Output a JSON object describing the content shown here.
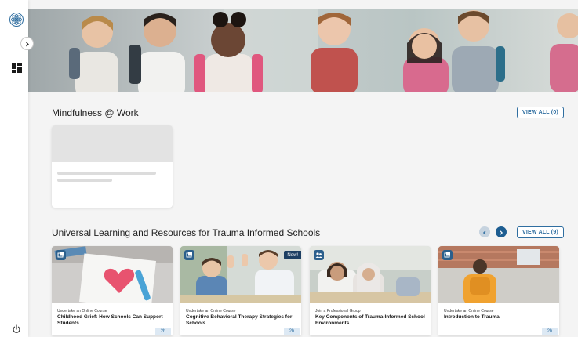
{
  "sidebar": {
    "logo_icon": "flower-logo-icon",
    "collapse_icon": "chevron-right-icon",
    "dashboard_icon": "dashboard-grid-icon",
    "power_icon": "power-icon"
  },
  "hero": {
    "image": "children-with-backpacks-photo"
  },
  "mindfulness": {
    "title": "Mindfulness @ Work",
    "view_all": "VIEW ALL (0)"
  },
  "trauma": {
    "title": "Universal Learning and Resources for Trauma Informed Schools",
    "view_all": "VIEW ALL (9)",
    "prev_icon": "chevron-left-icon",
    "next_icon": "chevron-right-icon",
    "cards": [
      {
        "type": "Undertake an Online Course",
        "title": "Childhood Grief: How Schools Can Support Students",
        "duration": "2h",
        "new": ""
      },
      {
        "type": "Undertake an Online Course",
        "title": "Cognitive Behavioral Therapy Strategies for Schools",
        "duration": "2h",
        "new": "New!"
      },
      {
        "type": "Join a Professional Group",
        "title": "Key Components of Trauma-Informed School Environments",
        "duration": "",
        "new": ""
      },
      {
        "type": "Undertake an Online Course",
        "title": "Introduction to Trauma",
        "duration": "2h",
        "new": ""
      }
    ]
  },
  "colors": {
    "accent": "#2f6ea0",
    "dark_accent": "#1d3f63",
    "background": "#f4f4f4"
  }
}
